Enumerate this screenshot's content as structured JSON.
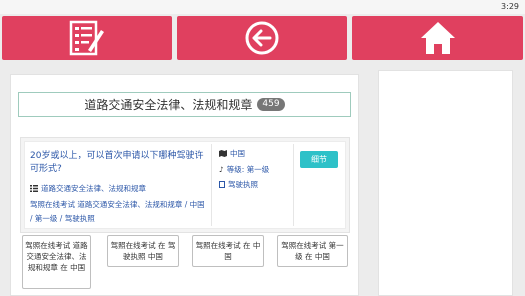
{
  "status": {
    "time": "3:29"
  },
  "colors": {
    "topbar": "#e0405f",
    "accent_button": "#2ec1c8",
    "link": "#2c57a8"
  },
  "topbar": {
    "buttons": [
      {
        "icon": "checklist-icon"
      },
      {
        "icon": "back-arrow-icon"
      },
      {
        "icon": "home-icon"
      }
    ]
  },
  "category": {
    "title": "道路交通安全法律、法规和规章",
    "count": "459"
  },
  "question": {
    "text": "20岁或以上，可以首次申请以下哪种驾驶许可形式?",
    "category_label": "道路交通安全法律、法规和规章",
    "tags_line": "驾照在线考试 道路交通安全法律、法规和规章 / 中国 / 第一级 / 驾驶执照",
    "region": "中国",
    "level": "等级: 第一级",
    "license": "驾驶执照",
    "detail_button": "细节"
  },
  "tag_buttons": [
    "驾照在线考试 道路交通安全法律、法规和规章 在 中国",
    "驾照在线考试 在 驾驶执照 中国",
    "驾照在线考试 在 中国",
    "驾照在线考试 第一级 在 中国"
  ]
}
